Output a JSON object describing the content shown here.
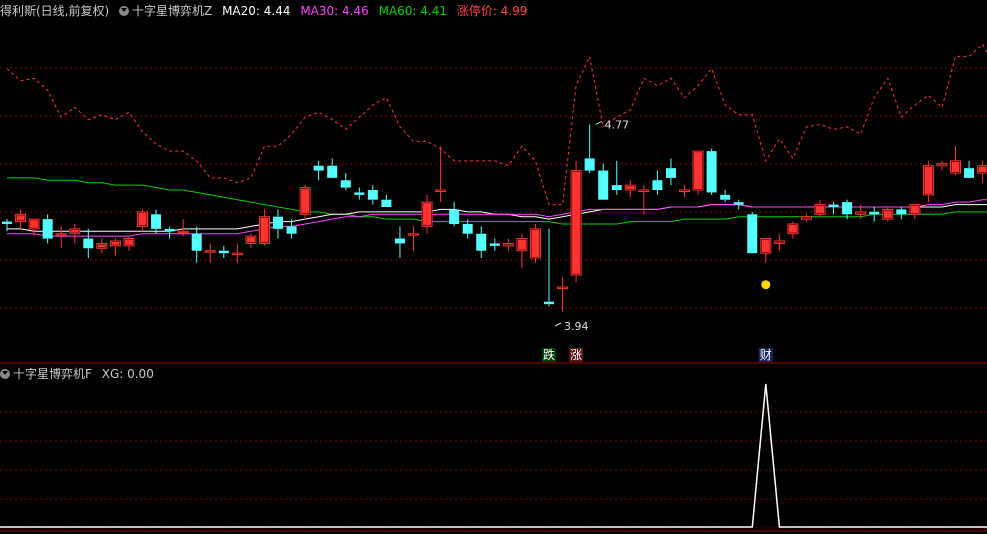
{
  "header_top": {
    "stock": "得利斯(日线,前复权)",
    "indicator": "十字星博弈机Z",
    "ma20_label": "MA20: 4.44",
    "ma30_label": "MA30: 4.46",
    "ma60_label": "MA60: 4.41",
    "limit_label": "涨停价: 4.99"
  },
  "header_bottom": {
    "indicator": "十字星博弈机F",
    "xg_label": "XG: 0.00"
  },
  "colors": {
    "up": "#ff3232",
    "down": "#54ffff",
    "ma20": "#ffffff",
    "ma30": "#ff44ff",
    "ma60": "#00d000",
    "limit": "#ff3232",
    "grid": "#7a0000",
    "signal_die": "#00b000",
    "signal_zhang": "#ff3232",
    "signal_cai": "#3c6cff",
    "dot": "#ffd800"
  },
  "chart_data": [
    {
      "type": "candlestick",
      "ylim": [
        3.8,
        5.2
      ],
      "candles": [
        [
          4.37,
          4.38,
          4.33,
          4.36
        ],
        [
          4.37,
          4.42,
          4.34,
          4.4
        ],
        [
          4.34,
          4.38,
          4.31,
          4.38
        ],
        [
          4.38,
          4.4,
          4.28,
          4.3
        ],
        [
          4.32,
          4.35,
          4.26,
          4.32
        ],
        [
          4.32,
          4.36,
          4.28,
          4.34
        ],
        [
          4.3,
          4.34,
          4.22,
          4.26
        ],
        [
          4.26,
          4.3,
          4.24,
          4.28
        ],
        [
          4.27,
          4.3,
          4.23,
          4.29
        ],
        [
          4.27,
          4.31,
          4.25,
          4.3
        ],
        [
          4.35,
          4.42,
          4.33,
          4.41
        ],
        [
          4.4,
          4.42,
          4.32,
          4.34
        ],
        [
          4.34,
          4.35,
          4.3,
          4.33
        ],
        [
          4.33,
          4.38,
          4.31,
          4.33
        ],
        [
          4.32,
          4.35,
          4.2,
          4.25
        ],
        [
          4.25,
          4.28,
          4.2,
          4.25
        ],
        [
          4.25,
          4.27,
          4.22,
          4.24
        ],
        [
          4.24,
          4.28,
          4.2,
          4.24
        ],
        [
          4.28,
          4.32,
          4.26,
          4.31
        ],
        [
          4.28,
          4.42,
          4.27,
          4.39
        ],
        [
          4.39,
          4.42,
          4.3,
          4.34
        ],
        [
          4.35,
          4.38,
          4.3,
          4.32
        ],
        [
          4.4,
          4.52,
          4.38,
          4.51
        ],
        [
          4.6,
          4.62,
          4.54,
          4.58
        ],
        [
          4.6,
          4.63,
          4.55,
          4.55
        ],
        [
          4.54,
          4.57,
          4.5,
          4.51
        ],
        [
          4.49,
          4.51,
          4.46,
          4.48
        ],
        [
          4.5,
          4.52,
          4.44,
          4.46
        ],
        [
          4.46,
          4.48,
          4.43,
          4.43
        ],
        [
          4.3,
          4.35,
          4.22,
          4.28
        ],
        [
          4.32,
          4.35,
          4.25,
          4.32
        ],
        [
          4.35,
          4.48,
          4.32,
          4.45
        ],
        [
          4.5,
          4.68,
          4.45,
          4.5
        ],
        [
          4.42,
          4.45,
          4.35,
          4.36
        ],
        [
          4.36,
          4.38,
          4.3,
          4.32
        ],
        [
          4.32,
          4.35,
          4.22,
          4.25
        ],
        [
          4.28,
          4.3,
          4.25,
          4.27
        ],
        [
          4.27,
          4.3,
          4.25,
          4.28
        ],
        [
          4.25,
          4.32,
          4.18,
          4.3
        ],
        [
          4.22,
          4.36,
          4.2,
          4.34
        ],
        [
          4.04,
          4.34,
          4.02,
          4.03
        ],
        [
          4.1,
          4.14,
          4.0,
          4.1
        ],
        [
          4.15,
          4.62,
          4.12,
          4.58
        ],
        [
          4.63,
          4.77,
          4.57,
          4.58
        ],
        [
          4.58,
          4.61,
          4.47,
          4.46
        ],
        [
          4.52,
          4.62,
          4.48,
          4.5
        ],
        [
          4.5,
          4.54,
          4.47,
          4.52
        ],
        [
          4.5,
          4.52,
          4.4,
          4.5
        ],
        [
          4.54,
          4.58,
          4.48,
          4.5
        ],
        [
          4.59,
          4.63,
          4.52,
          4.55
        ],
        [
          4.5,
          4.52,
          4.47,
          4.5
        ],
        [
          4.5,
          4.66,
          4.48,
          4.66
        ],
        [
          4.66,
          4.67,
          4.48,
          4.49
        ],
        [
          4.48,
          4.5,
          4.45,
          4.46
        ],
        [
          4.45,
          4.46,
          4.42,
          4.44
        ],
        [
          4.4,
          4.41,
          4.24,
          4.24
        ],
        [
          4.24,
          4.3,
          4.2,
          4.3
        ],
        [
          4.28,
          4.32,
          4.25,
          4.29
        ],
        [
          4.32,
          4.37,
          4.3,
          4.36
        ],
        [
          4.38,
          4.4,
          4.37,
          4.39
        ],
        [
          4.4,
          4.46,
          4.39,
          4.44
        ],
        [
          4.44,
          4.45,
          4.4,
          4.43
        ],
        [
          4.45,
          4.46,
          4.38,
          4.4
        ],
        [
          4.4,
          4.44,
          4.38,
          4.41
        ],
        [
          4.41,
          4.43,
          4.37,
          4.4
        ],
        [
          4.38,
          4.43,
          4.37,
          4.42
        ],
        [
          4.42,
          4.43,
          4.38,
          4.4
        ],
        [
          4.4,
          4.44,
          4.38,
          4.44
        ],
        [
          4.48,
          4.62,
          4.45,
          4.6
        ],
        [
          4.6,
          4.62,
          4.58,
          4.61
        ],
        [
          4.57,
          4.68,
          4.56,
          4.62
        ],
        [
          4.59,
          4.62,
          4.55,
          4.55
        ],
        [
          4.57,
          4.62,
          4.53,
          4.6
        ],
        [
          4.48,
          4.5,
          4.47,
          4.51
        ]
      ],
      "ma20": [
        4.34,
        4.34,
        4.33,
        4.33,
        4.33,
        4.33,
        4.33,
        4.33,
        4.33,
        4.33,
        4.33,
        4.33,
        4.33,
        4.34,
        4.34,
        4.34,
        4.34,
        4.34,
        4.35,
        4.36,
        4.37,
        4.37,
        4.38,
        4.39,
        4.4,
        4.4,
        4.41,
        4.41,
        4.41,
        4.41,
        4.41,
        4.41,
        4.42,
        4.42,
        4.41,
        4.41,
        4.4,
        4.4,
        4.39,
        4.39,
        4.38,
        4.39,
        4.4,
        4.41,
        4.42,
        4.42,
        4.42,
        4.42,
        4.42,
        4.43,
        4.43,
        4.43,
        4.44,
        4.44,
        4.44,
        4.43,
        4.43,
        4.43,
        4.43,
        4.43,
        4.43,
        4.43,
        4.43,
        4.43,
        4.43,
        4.43,
        4.43,
        4.43,
        4.43,
        4.43,
        4.44,
        4.44,
        4.44,
        4.44
      ],
      "ma30": [
        4.32,
        4.32,
        4.32,
        4.31,
        4.31,
        4.31,
        4.31,
        4.31,
        4.31,
        4.31,
        4.32,
        4.32,
        4.32,
        4.32,
        4.32,
        4.32,
        4.32,
        4.32,
        4.33,
        4.34,
        4.35,
        4.35,
        4.36,
        4.37,
        4.38,
        4.39,
        4.39,
        4.4,
        4.4,
        4.4,
        4.4,
        4.4,
        4.4,
        4.4,
        4.4,
        4.4,
        4.4,
        4.4,
        4.4,
        4.4,
        4.39,
        4.4,
        4.41,
        4.42,
        4.42,
        4.42,
        4.42,
        4.42,
        4.42,
        4.43,
        4.43,
        4.43,
        4.44,
        4.44,
        4.44,
        4.43,
        4.43,
        4.43,
        4.43,
        4.43,
        4.43,
        4.43,
        4.43,
        4.43,
        4.43,
        4.43,
        4.43,
        4.43,
        4.44,
        4.44,
        4.45,
        4.45,
        4.46,
        4.46
      ],
      "ma60": [
        4.55,
        4.55,
        4.55,
        4.54,
        4.54,
        4.54,
        4.53,
        4.53,
        4.52,
        4.52,
        4.52,
        4.51,
        4.5,
        4.5,
        4.49,
        4.48,
        4.47,
        4.46,
        4.45,
        4.44,
        4.43,
        4.42,
        4.41,
        4.41,
        4.4,
        4.4,
        4.39,
        4.39,
        4.38,
        4.38,
        4.38,
        4.37,
        4.37,
        4.37,
        4.37,
        4.37,
        4.37,
        4.37,
        4.37,
        4.37,
        4.37,
        4.36,
        4.36,
        4.36,
        4.36,
        4.36,
        4.37,
        4.37,
        4.37,
        4.37,
        4.38,
        4.38,
        4.38,
        4.38,
        4.39,
        4.39,
        4.39,
        4.39,
        4.39,
        4.39,
        4.39,
        4.39,
        4.39,
        4.39,
        4.4,
        4.4,
        4.4,
        4.4,
        4.4,
        4.4,
        4.41,
        4.41,
        4.41,
        4.41
      ],
      "limit_price": [
        5.0,
        4.95,
        4.96,
        4.91,
        4.8,
        4.84,
        4.79,
        4.81,
        4.79,
        4.82,
        4.74,
        4.69,
        4.66,
        4.66,
        4.62,
        4.55,
        4.55,
        4.53,
        4.55,
        4.68,
        4.68,
        4.73,
        4.8,
        4.82,
        4.79,
        4.75,
        4.8,
        4.85,
        4.88,
        4.76,
        4.7,
        4.7,
        4.67,
        4.62,
        4.62,
        4.62,
        4.62,
        4.6,
        4.68,
        4.62,
        4.44,
        4.44,
        4.93,
        5.05,
        4.76,
        4.8,
        4.83,
        4.96,
        4.93,
        4.96,
        4.88,
        4.93,
        5.0,
        4.85,
        4.81,
        4.81,
        4.62,
        4.71,
        4.63,
        4.76,
        4.77,
        4.75,
        4.76,
        4.73,
        4.88,
        4.96,
        4.8,
        4.85,
        4.89,
        4.84,
        5.05,
        5.05,
        5.1,
        5.0
      ],
      "annotations": [
        {
          "index": 43,
          "price": 4.77,
          "label": "4.77"
        },
        {
          "index": 40,
          "price": 3.94,
          "label": "3.94"
        }
      ],
      "signals": [
        {
          "index": 40,
          "label": "跌"
        },
        {
          "index": 42,
          "label": "涨"
        },
        {
          "index": 56,
          "label": "财"
        }
      ],
      "dot": {
        "index": 56,
        "price": 4.11
      }
    },
    {
      "type": "line",
      "series": [
        {
          "name": "XG",
          "spike_index": 56,
          "spike_value": 1,
          "base_value": 0
        }
      ]
    }
  ]
}
